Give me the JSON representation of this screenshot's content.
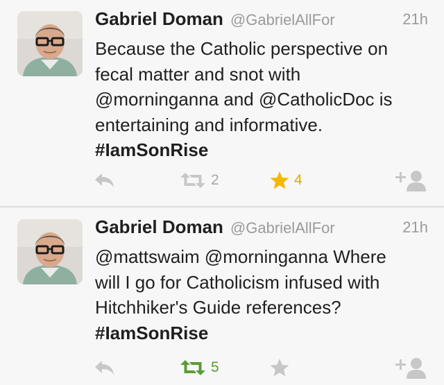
{
  "colors": {
    "icon_gray": "#c7c7c7",
    "retweet_active": "#5c9a36",
    "favorite_active": "#f5b800",
    "text": "#1f1f1f",
    "secondary_text": "#9a9a9a"
  },
  "tweets": [
    {
      "author_name": "Gabriel Doman",
      "handle": "@GabrielAllFor",
      "time": "21h",
      "lines": [
        "Because the Catholic perspective on",
        "fecal matter and snot with",
        "@morninganna and @CatholicDoc is",
        "entertaining and informative."
      ],
      "hashtag": "#IamSonRise",
      "retweet_count": "2",
      "favorite_count": "4",
      "retweeted": false,
      "favorited": true
    },
    {
      "author_name": "Gabriel Doman",
      "handle": "@GabrielAllFor",
      "time": "21h",
      "lines": [
        "@mattswaim @morninganna Where",
        "will I go for Catholicism infused with",
        "Hitchhiker's Guide references?"
      ],
      "hashtag": "#IamSonRise",
      "retweet_count": "5",
      "favorite_count": "",
      "retweeted": true,
      "favorited": false
    }
  ]
}
